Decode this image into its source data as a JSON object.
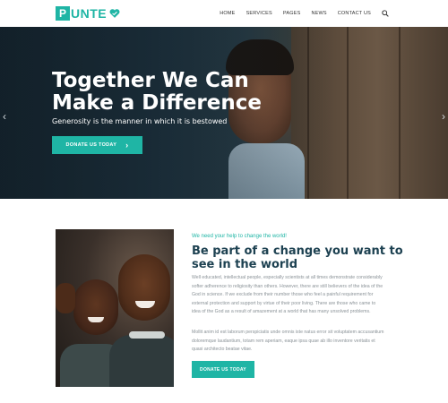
{
  "brand": {
    "logo_letter": "P",
    "logo_text": "UNTE",
    "accent_color": "#1fb5a5",
    "heading_color": "#1d4151"
  },
  "nav": {
    "items": [
      "HOME",
      "SERVICES",
      "PAGES",
      "NEWS",
      "CONTACT US"
    ],
    "search_icon": "search-icon"
  },
  "hero": {
    "title": "Together We Can Make a Difference",
    "subtitle": "Generosity is the manner in which it is bestowed",
    "button_label": "DONATE US TODAY",
    "prev_arrow": "‹",
    "next_arrow": "›"
  },
  "content": {
    "tagline": "We need your help to change the world!",
    "heading": "Be part of a change you want to see in the world",
    "paragraph1": "Well educated, intellectual people, especially scientists at all times demonstrate considerably softer adherence to religiosity than others. However, there are still believers of the idea of the God in science. If we exclude from their number those who feel a painful requirement for external protection and support by virtue of their poor living. There are those who came to idea of the God as a result of amazement at a world that has many unsolved problems.",
    "paragraph2": "Mollit anim id est laborum perspiciatis unde omnis iste natus error sit voluptatem accusantium doloremque laudantium, totam rem aperiam, eaque ipsa quae ab illo inventore veritatis et quasi architecto beatae vitae.",
    "button_label": "DONATE US TODAY"
  }
}
